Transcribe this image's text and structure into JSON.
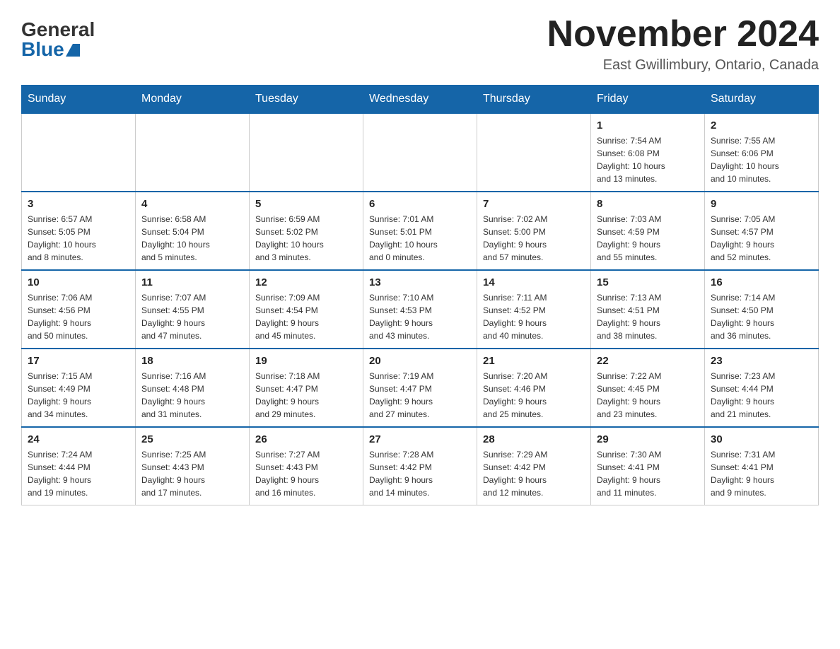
{
  "header": {
    "logo_general": "General",
    "logo_blue": "Blue",
    "month_title": "November 2024",
    "location": "East Gwillimbury, Ontario, Canada"
  },
  "days_of_week": [
    "Sunday",
    "Monday",
    "Tuesday",
    "Wednesday",
    "Thursday",
    "Friday",
    "Saturday"
  ],
  "weeks": [
    [
      {
        "day": "",
        "info": ""
      },
      {
        "day": "",
        "info": ""
      },
      {
        "day": "",
        "info": ""
      },
      {
        "day": "",
        "info": ""
      },
      {
        "day": "",
        "info": ""
      },
      {
        "day": "1",
        "info": "Sunrise: 7:54 AM\nSunset: 6:08 PM\nDaylight: 10 hours\nand 13 minutes."
      },
      {
        "day": "2",
        "info": "Sunrise: 7:55 AM\nSunset: 6:06 PM\nDaylight: 10 hours\nand 10 minutes."
      }
    ],
    [
      {
        "day": "3",
        "info": "Sunrise: 6:57 AM\nSunset: 5:05 PM\nDaylight: 10 hours\nand 8 minutes."
      },
      {
        "day": "4",
        "info": "Sunrise: 6:58 AM\nSunset: 5:04 PM\nDaylight: 10 hours\nand 5 minutes."
      },
      {
        "day": "5",
        "info": "Sunrise: 6:59 AM\nSunset: 5:02 PM\nDaylight: 10 hours\nand 3 minutes."
      },
      {
        "day": "6",
        "info": "Sunrise: 7:01 AM\nSunset: 5:01 PM\nDaylight: 10 hours\nand 0 minutes."
      },
      {
        "day": "7",
        "info": "Sunrise: 7:02 AM\nSunset: 5:00 PM\nDaylight: 9 hours\nand 57 minutes."
      },
      {
        "day": "8",
        "info": "Sunrise: 7:03 AM\nSunset: 4:59 PM\nDaylight: 9 hours\nand 55 minutes."
      },
      {
        "day": "9",
        "info": "Sunrise: 7:05 AM\nSunset: 4:57 PM\nDaylight: 9 hours\nand 52 minutes."
      }
    ],
    [
      {
        "day": "10",
        "info": "Sunrise: 7:06 AM\nSunset: 4:56 PM\nDaylight: 9 hours\nand 50 minutes."
      },
      {
        "day": "11",
        "info": "Sunrise: 7:07 AM\nSunset: 4:55 PM\nDaylight: 9 hours\nand 47 minutes."
      },
      {
        "day": "12",
        "info": "Sunrise: 7:09 AM\nSunset: 4:54 PM\nDaylight: 9 hours\nand 45 minutes."
      },
      {
        "day": "13",
        "info": "Sunrise: 7:10 AM\nSunset: 4:53 PM\nDaylight: 9 hours\nand 43 minutes."
      },
      {
        "day": "14",
        "info": "Sunrise: 7:11 AM\nSunset: 4:52 PM\nDaylight: 9 hours\nand 40 minutes."
      },
      {
        "day": "15",
        "info": "Sunrise: 7:13 AM\nSunset: 4:51 PM\nDaylight: 9 hours\nand 38 minutes."
      },
      {
        "day": "16",
        "info": "Sunrise: 7:14 AM\nSunset: 4:50 PM\nDaylight: 9 hours\nand 36 minutes."
      }
    ],
    [
      {
        "day": "17",
        "info": "Sunrise: 7:15 AM\nSunset: 4:49 PM\nDaylight: 9 hours\nand 34 minutes."
      },
      {
        "day": "18",
        "info": "Sunrise: 7:16 AM\nSunset: 4:48 PM\nDaylight: 9 hours\nand 31 minutes."
      },
      {
        "day": "19",
        "info": "Sunrise: 7:18 AM\nSunset: 4:47 PM\nDaylight: 9 hours\nand 29 minutes."
      },
      {
        "day": "20",
        "info": "Sunrise: 7:19 AM\nSunset: 4:47 PM\nDaylight: 9 hours\nand 27 minutes."
      },
      {
        "day": "21",
        "info": "Sunrise: 7:20 AM\nSunset: 4:46 PM\nDaylight: 9 hours\nand 25 minutes."
      },
      {
        "day": "22",
        "info": "Sunrise: 7:22 AM\nSunset: 4:45 PM\nDaylight: 9 hours\nand 23 minutes."
      },
      {
        "day": "23",
        "info": "Sunrise: 7:23 AM\nSunset: 4:44 PM\nDaylight: 9 hours\nand 21 minutes."
      }
    ],
    [
      {
        "day": "24",
        "info": "Sunrise: 7:24 AM\nSunset: 4:44 PM\nDaylight: 9 hours\nand 19 minutes."
      },
      {
        "day": "25",
        "info": "Sunrise: 7:25 AM\nSunset: 4:43 PM\nDaylight: 9 hours\nand 17 minutes."
      },
      {
        "day": "26",
        "info": "Sunrise: 7:27 AM\nSunset: 4:43 PM\nDaylight: 9 hours\nand 16 minutes."
      },
      {
        "day": "27",
        "info": "Sunrise: 7:28 AM\nSunset: 4:42 PM\nDaylight: 9 hours\nand 14 minutes."
      },
      {
        "day": "28",
        "info": "Sunrise: 7:29 AM\nSunset: 4:42 PM\nDaylight: 9 hours\nand 12 minutes."
      },
      {
        "day": "29",
        "info": "Sunrise: 7:30 AM\nSunset: 4:41 PM\nDaylight: 9 hours\nand 11 minutes."
      },
      {
        "day": "30",
        "info": "Sunrise: 7:31 AM\nSunset: 4:41 PM\nDaylight: 9 hours\nand 9 minutes."
      }
    ]
  ]
}
